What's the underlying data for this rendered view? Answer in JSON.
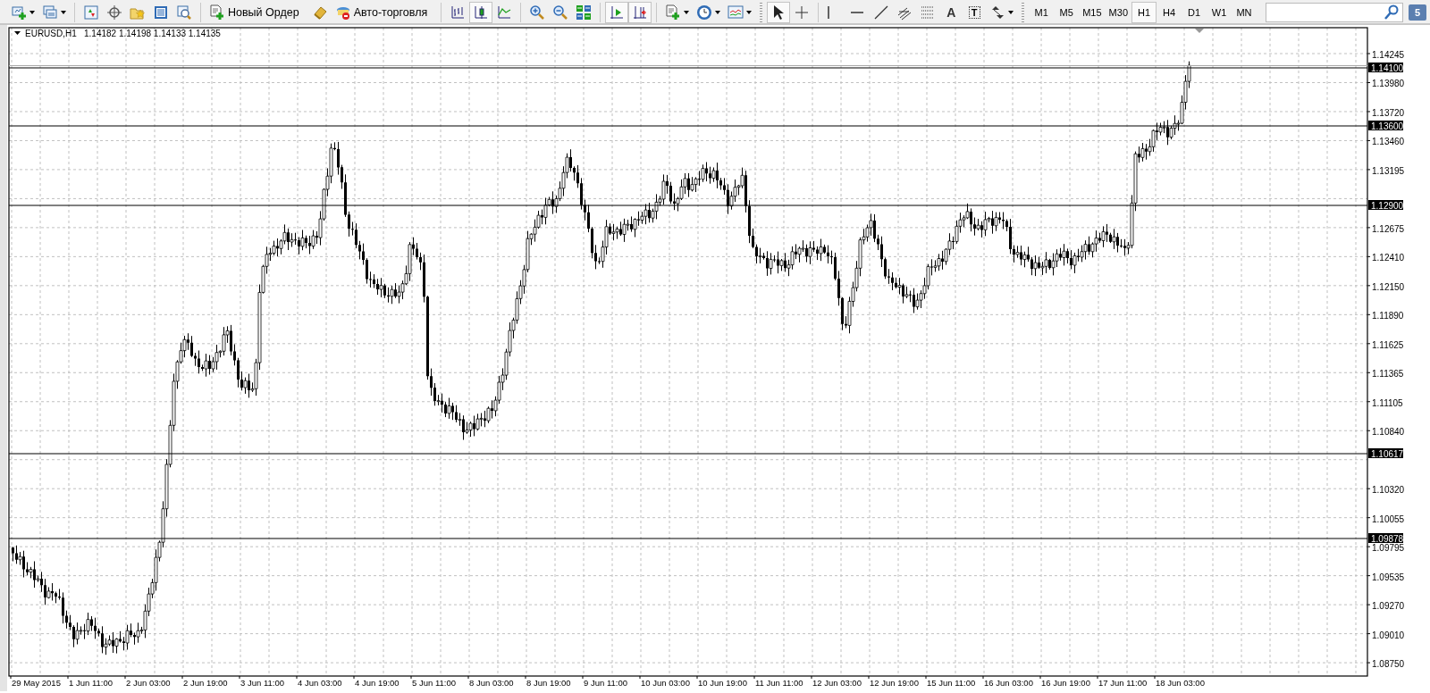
{
  "toolbar": {
    "text_buttons": [
      {
        "label": "Новый Ордер"
      },
      {
        "label": "Авто-торговля"
      }
    ],
    "chart_types": [
      {
        "selected": false
      },
      {
        "selected": true
      },
      {
        "selected": false
      }
    ],
    "chart_shift": {
      "on": true
    },
    "autoscroll": {
      "on": true
    },
    "cursor_tools": [
      {
        "selected": true
      },
      {
        "selected": false
      }
    ],
    "text_tool": "A",
    "label_tool": "T",
    "timeframes": [
      {
        "label": "M1",
        "selected": false
      },
      {
        "label": "M5",
        "selected": false
      },
      {
        "label": "M15",
        "selected": false
      },
      {
        "label": "M30",
        "selected": false
      },
      {
        "label": "H1",
        "selected": true
      },
      {
        "label": "H4",
        "selected": false
      },
      {
        "label": "D1",
        "selected": false
      },
      {
        "label": "W1",
        "selected": false
      },
      {
        "label": "MN",
        "selected": false
      }
    ],
    "notification_count": "5"
  },
  "chart": {
    "symbol": "EURUSD,H1",
    "quote": "1.14182 1.14198 1.14133 1.14135",
    "price_ticks": [
      "1.14245",
      "1.13980",
      "1.13720",
      "1.13460",
      "1.13195",
      "1.12675",
      "1.12410",
      "1.12150",
      "1.11890",
      "1.11625",
      "1.11365",
      "1.11105",
      "1.10840",
      "1.10320",
      "1.10055",
      "1.09795",
      "1.09535",
      "1.09270",
      "1.09010",
      "1.08750"
    ],
    "level_lines": [
      {
        "label": "1.14100"
      },
      {
        "label": "1.13600"
      },
      {
        "label": "1.12900"
      },
      {
        "label": "1.10617"
      },
      {
        "label": "1.09878"
      }
    ],
    "time_labels": [
      "29 May 2015",
      "1 Jun 11:00",
      "2 Jun 03:00",
      "2 Jun 19:00",
      "3 Jun 11:00",
      "4 Jun 03:00",
      "4 Jun 19:00",
      "5 Jun 11:00",
      "8 Jun 03:00",
      "8 Jun 19:00",
      "9 Jun 11:00",
      "10 Jun 03:00",
      "10 Jun 19:00",
      "11 Jun 11:00",
      "12 Jun 03:00",
      "12 Jun 19:00",
      "15 Jun 11:00",
      "16 Jun 03:00",
      "16 Jun 19:00",
      "17 Jun 11:00",
      "18 Jun 03:00"
    ]
  }
}
